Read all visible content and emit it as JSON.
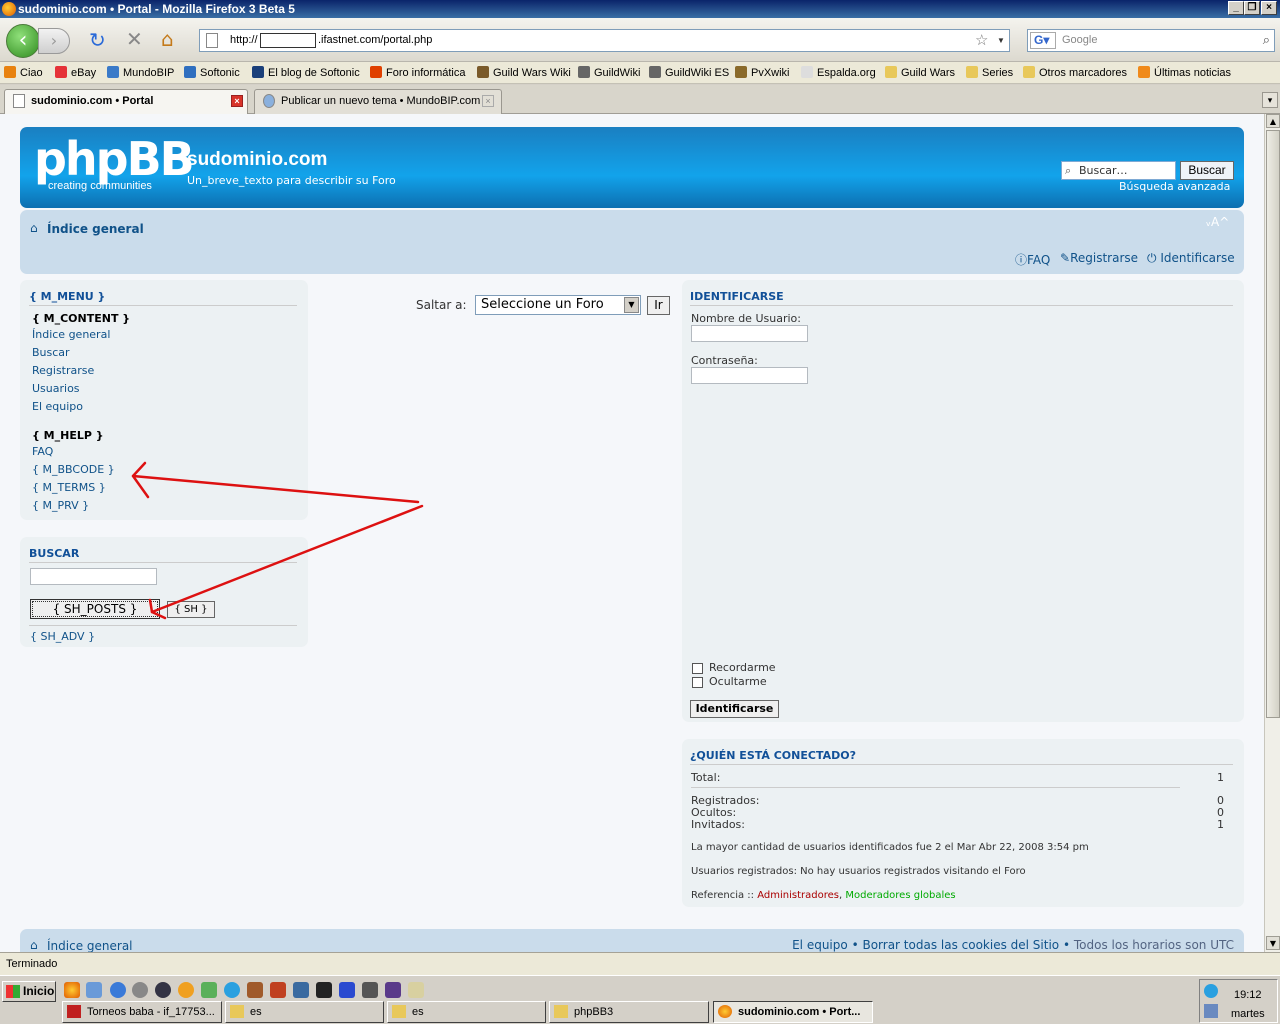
{
  "window": {
    "title": "sudominio.com • Portal - Mozilla Firefox 3 Beta 5"
  },
  "nav": {
    "url_prefix": "http://",
    "url_suffix": ".ifastnet.com/portal.php",
    "search_placeholder": "Google"
  },
  "bookmarks": [
    {
      "label": "Ciao",
      "color": "#e8820f"
    },
    {
      "label": "eBay",
      "color": "#e53238"
    },
    {
      "label": "MundoBIP",
      "color": "#3a7ac8"
    },
    {
      "label": "Softonic",
      "color": "#2f6fbf"
    },
    {
      "label": "El blog de Softonic",
      "color": "#1a3f7a"
    },
    {
      "label": "Foro informática",
      "color": "#e04000"
    },
    {
      "label": "Guild Wars Wiki",
      "color": "#7a5a2a"
    },
    {
      "label": "GuildWiki",
      "color": "#666666"
    },
    {
      "label": "GuildWiki ES",
      "color": "#666666"
    },
    {
      "label": "PvXwiki",
      "color": "#8a6a2a"
    },
    {
      "label": "Espalda.org",
      "color": "#dddddd"
    },
    {
      "label": "Guild Wars",
      "color": "#e8c85a"
    },
    {
      "label": "Series",
      "color": "#e8c85a"
    },
    {
      "label": "Otros marcadores",
      "color": "#e8c85a"
    },
    {
      "label": "Últimas noticias",
      "color": "#f08a1a"
    }
  ],
  "tabs": [
    {
      "label": "sudominio.com • Portal",
      "active": true
    },
    {
      "label": "Publicar un nuevo tema • MundoBIP.com",
      "active": false
    }
  ],
  "header": {
    "logo": "phpBB",
    "logo_sub": "creating  communities",
    "site_name": "sudominio.com",
    "site_desc": "Un_breve_texto para describir su Foro",
    "search_placeholder": "Buscar…",
    "search_button": "Buscar",
    "advanced_search": "Búsqueda avanzada"
  },
  "navstrip": {
    "index": "Índice general",
    "font_size": "ᵥA^",
    "faq": "FAQ",
    "register": "Registrarse",
    "login": "Identificarse"
  },
  "menu": {
    "title": "{ M_MENU }",
    "content_heading": "{ M_CONTENT }",
    "content_links": [
      "Índice general",
      "Buscar",
      "Registrarse",
      "Usuarios",
      "El equipo"
    ],
    "help_heading": "{ M_HELP }",
    "help_links": [
      "FAQ",
      "{ M_BBCODE }",
      "{ M_TERMS }",
      "{ M_PRV }"
    ]
  },
  "search_panel": {
    "title": "BUSCAR",
    "select_value": "{ SH_POSTS }",
    "button": "{ SH }",
    "advanced": "{ SH_ADV }"
  },
  "jump": {
    "label": "Saltar a:",
    "select_value": "Seleccione un Foro",
    "button": "Ir"
  },
  "login": {
    "title": "IDENTIFICARSE",
    "username_label": "Nombre de Usuario:",
    "password_label": "Contraseña:",
    "remember": "Recordarme",
    "hide": "Ocultarme",
    "button": "Identificarse"
  },
  "online": {
    "title": "¿QUIÉN ESTÁ CONECTADO?",
    "total_label": "Total:",
    "total": "1",
    "registered_label": "Registrados:",
    "registered": "0",
    "hidden_label": "Ocultos:",
    "hidden": "0",
    "guests_label": "Invitados:",
    "guests": "1",
    "record": "La mayor cantidad de usuarios identificados fue 2 el Mar Abr 22, 2008 3:54 pm",
    "registered_users": "Usuarios registrados: No hay usuarios registrados visitando el Foro",
    "legend_prefix": "Referencia :: ",
    "legend_admins": "Administradores",
    "legend_sep": ",",
    "legend_mods": "Moderadores globales",
    "admin_color": "#aa0000",
    "mod_color": "#00aa00"
  },
  "footer": {
    "index": "Índice general",
    "team": "El equipo",
    "sep": "•",
    "cookies": "Borrar todas las cookies del Sitio",
    "timezone": "Todos los horarios son UTC"
  },
  "status": "Terminado",
  "taskbar": {
    "start": "Inicio",
    "buttons": [
      {
        "label": "Torneos baba - if_17753...",
        "active": false
      },
      {
        "label": "es",
        "active": false
      },
      {
        "label": "es",
        "active": false
      },
      {
        "label": "phpBB3",
        "active": false
      },
      {
        "label": "sudominio.com • Port...",
        "active": true
      }
    ],
    "time": "19:12",
    "day": "martes"
  },
  "accent_color": "#105289",
  "arrow_color": "#dd1111"
}
